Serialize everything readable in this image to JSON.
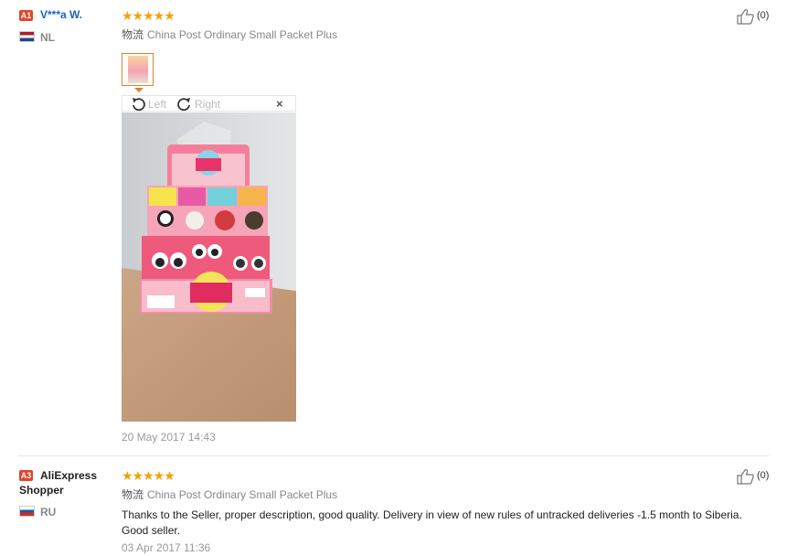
{
  "reviews": [
    {
      "level": "A1",
      "name": "V***a W.",
      "country": "NL",
      "shipping_label": "物流",
      "shipping_method": "China Post Ordinary Small Packet Plus",
      "likes": "(0)",
      "date": "20 May 2017 14:43",
      "viewer": {
        "left_label": "Left",
        "right_label": "Right",
        "close_label": "×"
      }
    },
    {
      "level": "A3",
      "name": "AliExpress Shopper",
      "country": "RU",
      "shipping_label": "物流",
      "shipping_method": "China Post Ordinary Small Packet Plus",
      "likes": "(0)",
      "feedback": "Thanks to the Seller, proper description, good quality. Delivery in view of new rules of untracked deliveries -1.5 month to Siberia. Good seller.",
      "date": "03 Apr 2017 11:36"
    }
  ],
  "stars": "★★★★★",
  "colors": {
    "star": "#f5a10a",
    "badge": "#e0452a",
    "link": "#1a64c2",
    "thumb_border": "#e5802a"
  }
}
